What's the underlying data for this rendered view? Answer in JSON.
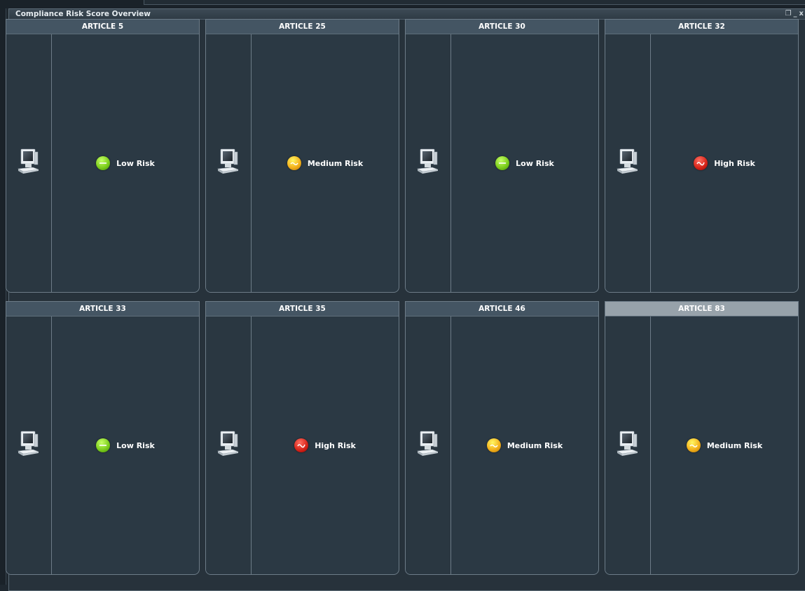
{
  "window": {
    "title": "Compliance Risk Score Overview",
    "controls": [
      "restore",
      "minimize",
      "close"
    ],
    "restore_glyph": "❐",
    "minimize_glyph": "_",
    "close_glyph": "x"
  },
  "colors": {
    "low": "#7fcf1f",
    "medium": "#f4b21d",
    "high": "#d9281c"
  },
  "articles": [
    {
      "title": "ARTICLE  5",
      "risk": "Low Risk",
      "level": "low",
      "icon": "computer-icon"
    },
    {
      "title": "ARTICLE 25",
      "risk": "Medium Risk",
      "level": "medium",
      "icon": "computer-icon"
    },
    {
      "title": "ARTICLE 30",
      "risk": "Low Risk",
      "level": "low",
      "icon": "computer-icon"
    },
    {
      "title": "ARTICLE 32",
      "risk": "High Risk",
      "level": "high",
      "icon": "computer-icon"
    },
    {
      "title": "ARTICLE 33",
      "risk": "Low Risk",
      "level": "low",
      "icon": "computer-icon"
    },
    {
      "title": "ARTICLE 35",
      "risk": "High Risk",
      "level": "high",
      "icon": "computer-icon"
    },
    {
      "title": "ARTICLE 46",
      "risk": "Medium Risk",
      "level": "medium",
      "icon": "computer-icon"
    },
    {
      "title": "ARTICLE 83",
      "risk": "Medium Risk",
      "level": "medium",
      "icon": "computer-icon",
      "selected": true
    }
  ]
}
